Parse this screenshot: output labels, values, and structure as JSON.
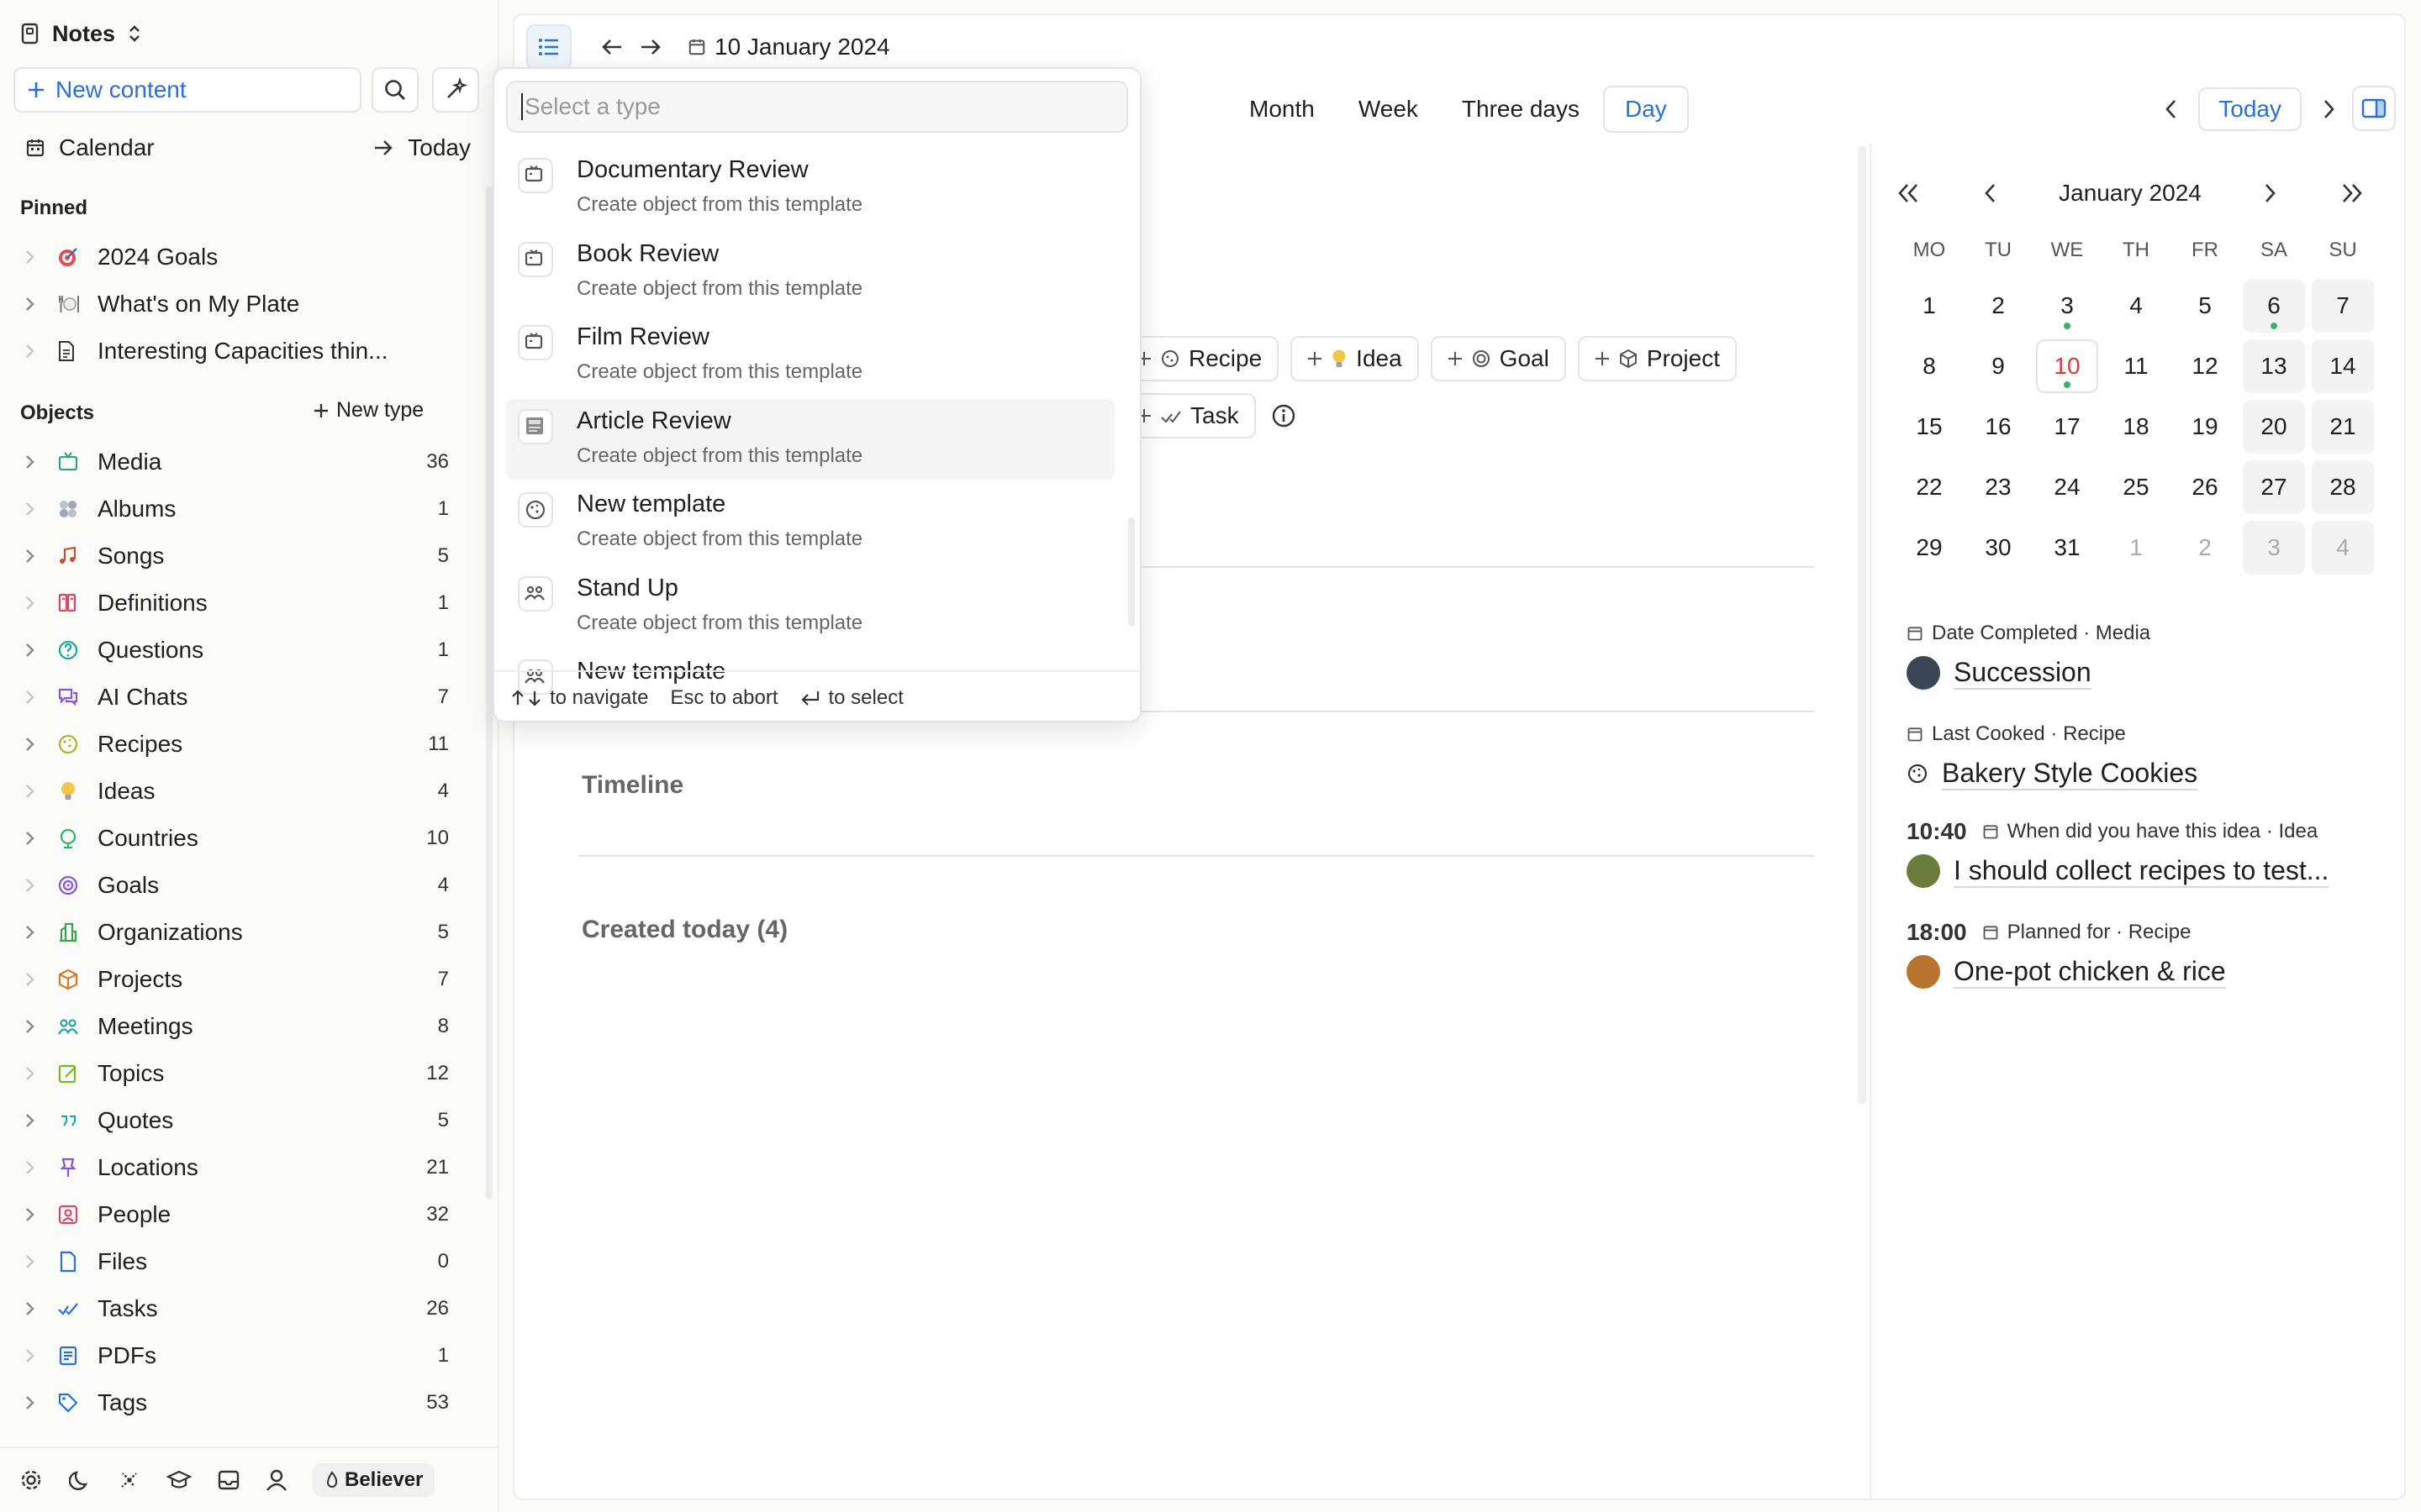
{
  "sidebar": {
    "space_name": "Notes",
    "new_content_label": "New content",
    "calendar_label": "Calendar",
    "today_label": "Today",
    "pinned_label": "Pinned",
    "pinned": [
      {
        "label": "2024 Goals",
        "icon": "target-icon"
      },
      {
        "label": "What's on My Plate",
        "icon": "plate-icon"
      },
      {
        "label": "Interesting Capacities thin...",
        "icon": "document-icon"
      }
    ],
    "objects_label": "Objects",
    "new_type_label": "New type",
    "objects": [
      {
        "label": "Media",
        "count": "36",
        "icon": "media-icon",
        "color": "#3ba17c"
      },
      {
        "label": "Albums",
        "count": "1",
        "icon": "albums-icon",
        "color": "#8a8fa3"
      },
      {
        "label": "Songs",
        "count": "5",
        "icon": "music-note-icon",
        "color": "#c8522e"
      },
      {
        "label": "Definitions",
        "count": "1",
        "icon": "book-icon",
        "color": "#d8486a"
      },
      {
        "label": "Questions",
        "count": "1",
        "icon": "question-icon",
        "color": "#1fa7a0"
      },
      {
        "label": "AI Chats",
        "count": "7",
        "icon": "chat-icon",
        "color": "#8b53d6"
      },
      {
        "label": "Recipes",
        "count": "11",
        "icon": "cookie-icon",
        "color": "#a7b72e"
      },
      {
        "label": "Ideas",
        "count": "4",
        "icon": "lightbulb-icon",
        "color": "#e5b428"
      },
      {
        "label": "Countries",
        "count": "10",
        "icon": "globe-icon",
        "color": "#2db46a"
      },
      {
        "label": "Goals",
        "count": "4",
        "icon": "target-icon",
        "color": "#8b53d6"
      },
      {
        "label": "Organizations",
        "count": "5",
        "icon": "building-icon",
        "color": "#3ba14a"
      },
      {
        "label": "Projects",
        "count": "7",
        "icon": "box-icon",
        "color": "#d87a2e"
      },
      {
        "label": "Meetings",
        "count": "8",
        "icon": "people-icon",
        "color": "#1fa7a0"
      },
      {
        "label": "Topics",
        "count": "12",
        "icon": "edit-icon",
        "color": "#7ab32e"
      },
      {
        "label": "Quotes",
        "count": "5",
        "icon": "quote-icon",
        "color": "#1fa7a0"
      },
      {
        "label": "Locations",
        "count": "21",
        "icon": "pin-icon",
        "color": "#8b53d6"
      },
      {
        "label": "People",
        "count": "32",
        "icon": "person-icon",
        "color": "#d8486a"
      },
      {
        "label": "Files",
        "count": "0",
        "icon": "file-icon",
        "color": "#2970d8"
      },
      {
        "label": "Tasks",
        "count": "26",
        "icon": "check-icon",
        "color": "#2970d8"
      },
      {
        "label": "PDFs",
        "count": "1",
        "icon": "pdf-icon",
        "color": "#2970d8"
      },
      {
        "label": "Tags",
        "count": "53",
        "icon": "tag-icon",
        "color": "#2970d8"
      }
    ],
    "badge_label": "Believer"
  },
  "toolbar": {
    "date_label": "10 January 2024"
  },
  "views": {
    "tabs": [
      "Month",
      "Week",
      "Three days",
      "Day"
    ],
    "active": "Day",
    "today_button": "Today"
  },
  "chips": {
    "row1": [
      "Recipe",
      "Idea",
      "Goal",
      "Project"
    ],
    "row2": [
      "Task"
    ]
  },
  "sections": {
    "timeline": "Timeline",
    "created_today": "Created today (4)"
  },
  "calendar": {
    "month_title": "January 2024",
    "weekdays": [
      "MO",
      "TU",
      "WE",
      "TH",
      "FR",
      "SA",
      "SU"
    ],
    "weeks": [
      [
        "1",
        "2",
        "3",
        "4",
        "5",
        "6",
        "7"
      ],
      [
        "8",
        "9",
        "10",
        "11",
        "12",
        "13",
        "14"
      ],
      [
        "15",
        "16",
        "17",
        "18",
        "19",
        "20",
        "21"
      ],
      [
        "22",
        "23",
        "24",
        "25",
        "26",
        "27",
        "28"
      ],
      [
        "29",
        "30",
        "31",
        "1",
        "2",
        "3",
        "4"
      ]
    ],
    "today": "10",
    "dots": [
      "3",
      "6",
      "10"
    ]
  },
  "events": [
    {
      "time": "",
      "meta": "Date Completed · Media",
      "title": "Succession",
      "avatar_color": "#3a4656"
    },
    {
      "time": "",
      "meta": "Last Cooked · Recipe",
      "title": "Bakery Style Cookies",
      "avatar_color": ""
    },
    {
      "time": "10:40",
      "meta": "When did you have this idea · Idea",
      "title": "I should collect recipes to test...",
      "avatar_color": "#6b7d3a"
    },
    {
      "time": "18:00",
      "meta": "Planned for · Recipe",
      "title": "One-pot chicken & rice",
      "avatar_color": "#b8742e"
    }
  ],
  "popup": {
    "placeholder": "Select a type",
    "items": [
      {
        "name": "Documentary Review",
        "sub": "Create object from this template"
      },
      {
        "name": "Book Review",
        "sub": "Create object from this template"
      },
      {
        "name": "Film Review",
        "sub": "Create object from this template"
      },
      {
        "name": "Article Review",
        "sub": "Create object from this template"
      },
      {
        "name": "New template",
        "sub": "Create object from this template"
      },
      {
        "name": "Stand Up",
        "sub": "Create object from this template"
      },
      {
        "name": "New template",
        "sub": ""
      }
    ],
    "footer": {
      "navigate": "to navigate",
      "abort": "Esc to abort",
      "select": "to select"
    }
  }
}
